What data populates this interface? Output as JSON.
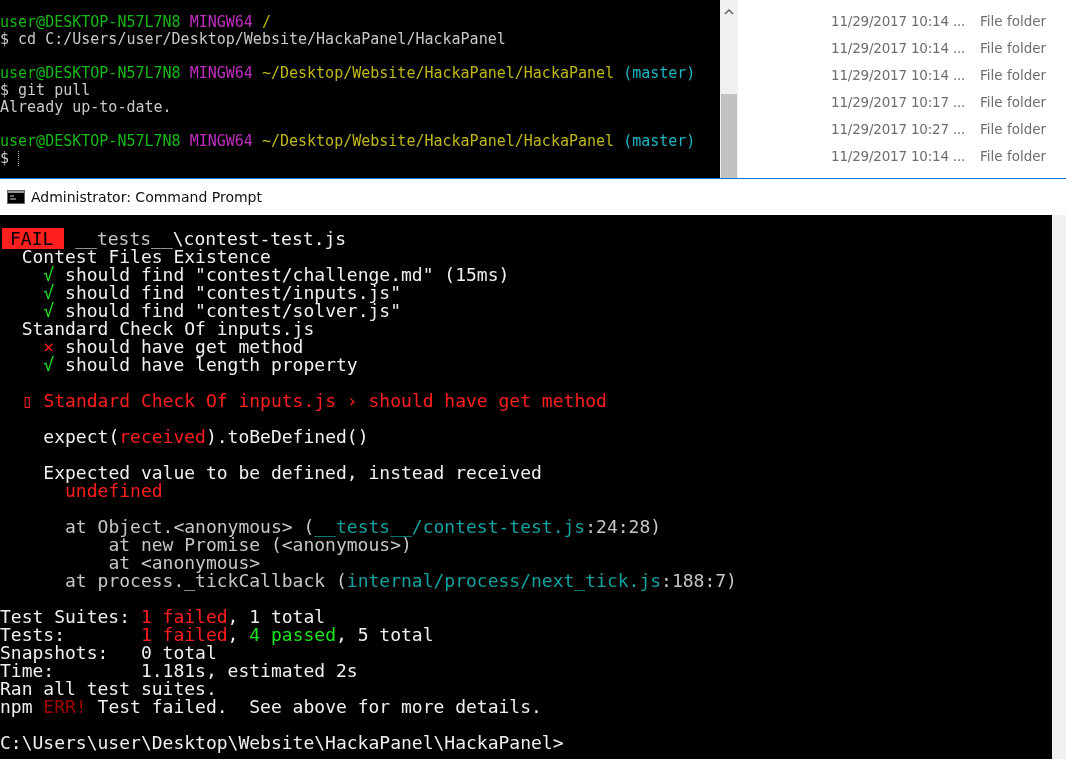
{
  "bash_terminal": {
    "lines": [
      {
        "kind": "text",
        "segments": [
          {
            "kind": "user",
            "text": "user@DESKTOP-N57L7N8 "
          },
          {
            "kind": "shell",
            "text": "MINGW64 "
          },
          {
            "kind": "path",
            "text": "/"
          }
        ]
      },
      {
        "kind": "text",
        "segments": [
          {
            "kind": "plain",
            "text": "$ cd C:/Users/user/Desktop/Website/HackaPanel/HackaPanel"
          }
        ]
      },
      {
        "kind": "blank"
      },
      {
        "kind": "text",
        "segments": [
          {
            "kind": "user",
            "text": "user@DESKTOP-N57L7N8 "
          },
          {
            "kind": "shell",
            "text": "MINGW64 "
          },
          {
            "kind": "path",
            "text": "~/Desktop/Website/HackaPanel/HackaPanel "
          },
          {
            "kind": "branch",
            "text": "(master)"
          }
        ]
      },
      {
        "kind": "text",
        "segments": [
          {
            "kind": "plain",
            "text": "$ git pull"
          }
        ]
      },
      {
        "kind": "text",
        "segments": [
          {
            "kind": "plain",
            "text": "Already up-to-date."
          }
        ]
      },
      {
        "kind": "blank"
      },
      {
        "kind": "text",
        "segments": [
          {
            "kind": "user",
            "text": "user@DESKTOP-N57L7N8 "
          },
          {
            "kind": "shell",
            "text": "MINGW64 "
          },
          {
            "kind": "path",
            "text": "~/Desktop/Website/HackaPanel/HackaPanel "
          },
          {
            "kind": "branch",
            "text": "(master)"
          }
        ]
      },
      {
        "kind": "text",
        "segments": [
          {
            "kind": "plain",
            "text": "$ "
          },
          {
            "kind": "cursor"
          }
        ]
      }
    ]
  },
  "explorer": {
    "rows": [
      {
        "date": "11/29/2017 10:14 ...",
        "type": "File folder"
      },
      {
        "date": "11/29/2017 10:14 ...",
        "type": "File folder"
      },
      {
        "date": "11/29/2017 10:14 ...",
        "type": "File folder"
      },
      {
        "date": "11/29/2017 10:17 ...",
        "type": "File folder"
      },
      {
        "date": "11/29/2017 10:27 ...",
        "type": "File folder"
      },
      {
        "date": "11/29/2017 10:14 ...",
        "type": "File folder"
      }
    ]
  },
  "command_prompt": {
    "title": "Administrator: Command Prompt",
    "lines": [
      {
        "kind": "text",
        "segments": [
          {
            "kind": "badge",
            "text": "FAIL"
          },
          {
            "kind": "dim",
            "text": " __tests__"
          },
          {
            "kind": "plain",
            "text": "\\contest-test.js"
          }
        ]
      },
      {
        "kind": "text",
        "segments": [
          {
            "kind": "plain",
            "text": "  Contest Files Existence"
          }
        ]
      },
      {
        "kind": "text",
        "segments": [
          {
            "kind": "check",
            "text": "    √"
          },
          {
            "kind": "plain",
            "text": " should find \"contest/challenge.md\" (15ms)"
          }
        ]
      },
      {
        "kind": "text",
        "segments": [
          {
            "kind": "check",
            "text": "    √"
          },
          {
            "kind": "plain",
            "text": " should find \"contest/inputs.js\""
          }
        ]
      },
      {
        "kind": "text",
        "segments": [
          {
            "kind": "check",
            "text": "    √"
          },
          {
            "kind": "plain",
            "text": " should find \"contest/solver.js\""
          }
        ]
      },
      {
        "kind": "text",
        "segments": [
          {
            "kind": "plain",
            "text": "  Standard Check Of inputs.js"
          }
        ]
      },
      {
        "kind": "text",
        "segments": [
          {
            "kind": "cross",
            "text": "    ×"
          },
          {
            "kind": "plain",
            "text": " should have get method"
          }
        ]
      },
      {
        "kind": "text",
        "segments": [
          {
            "kind": "check",
            "text": "    √"
          },
          {
            "kind": "plain",
            "text": " should have length property"
          }
        ]
      },
      {
        "kind": "blank"
      },
      {
        "kind": "text",
        "segments": [
          {
            "kind": "bullet",
            "text": "  ▯"
          },
          {
            "kind": "fail",
            "text": " Standard Check Of inputs.js › should have get method"
          }
        ]
      },
      {
        "kind": "blank"
      },
      {
        "kind": "text",
        "segments": [
          {
            "kind": "plain",
            "text": "    expect("
          },
          {
            "kind": "fail",
            "text": "received"
          },
          {
            "kind": "plain",
            "text": ").toBeDefined()"
          }
        ]
      },
      {
        "kind": "blank"
      },
      {
        "kind": "text",
        "segments": [
          {
            "kind": "plain",
            "text": "    Expected value to be defined, instead received"
          }
        ]
      },
      {
        "kind": "text",
        "segments": [
          {
            "kind": "fail",
            "text": "      undefined"
          }
        ]
      },
      {
        "kind": "blank"
      },
      {
        "kind": "text",
        "segments": [
          {
            "kind": "dim",
            "text": "      at Object.<anonymous> ("
          },
          {
            "kind": "link",
            "text": "__tests__/contest-test.js"
          },
          {
            "kind": "dim",
            "text": ":24:28)"
          }
        ]
      },
      {
        "kind": "text",
        "segments": [
          {
            "kind": "dim",
            "text": "          at new Promise (<anonymous>)"
          }
        ]
      },
      {
        "kind": "text",
        "segments": [
          {
            "kind": "dim",
            "text": "          at <anonymous>"
          }
        ]
      },
      {
        "kind": "text",
        "segments": [
          {
            "kind": "dim",
            "text": "      at process._tickCallback ("
          },
          {
            "kind": "link",
            "text": "internal/process/next_tick.js"
          },
          {
            "kind": "dim",
            "text": ":188:7)"
          }
        ]
      },
      {
        "kind": "blank"
      },
      {
        "kind": "text",
        "segments": [
          {
            "kind": "plain",
            "text": "Test Suites: "
          },
          {
            "kind": "fail",
            "text": "1 failed"
          },
          {
            "kind": "plain",
            "text": ", 1 total"
          }
        ]
      },
      {
        "kind": "text",
        "segments": [
          {
            "kind": "plain",
            "text": "Tests:       "
          },
          {
            "kind": "fail",
            "text": "1 failed"
          },
          {
            "kind": "plain",
            "text": ", "
          },
          {
            "kind": "pass",
            "text": "4 passed"
          },
          {
            "kind": "plain",
            "text": ", 5 total"
          }
        ]
      },
      {
        "kind": "text",
        "segments": [
          {
            "kind": "plain",
            "text": "Snapshots:   0 total"
          }
        ]
      },
      {
        "kind": "text",
        "segments": [
          {
            "kind": "plain",
            "text": "Time:        1.181s, estimated 2s"
          }
        ]
      },
      {
        "kind": "text",
        "segments": [
          {
            "kind": "plain",
            "text": "Ran all test suites."
          }
        ]
      },
      {
        "kind": "text",
        "segments": [
          {
            "kind": "plain",
            "text": "npm "
          },
          {
            "kind": "err",
            "text": "ERR!"
          },
          {
            "kind": "plain",
            "text": " Test failed.  See above for more details."
          }
        ]
      },
      {
        "kind": "blank"
      },
      {
        "kind": "text",
        "segments": [
          {
            "kind": "plain",
            "text": "C:\\Users\\user\\Desktop\\Website\\HackaPanel\\HackaPanel>"
          }
        ]
      }
    ]
  }
}
